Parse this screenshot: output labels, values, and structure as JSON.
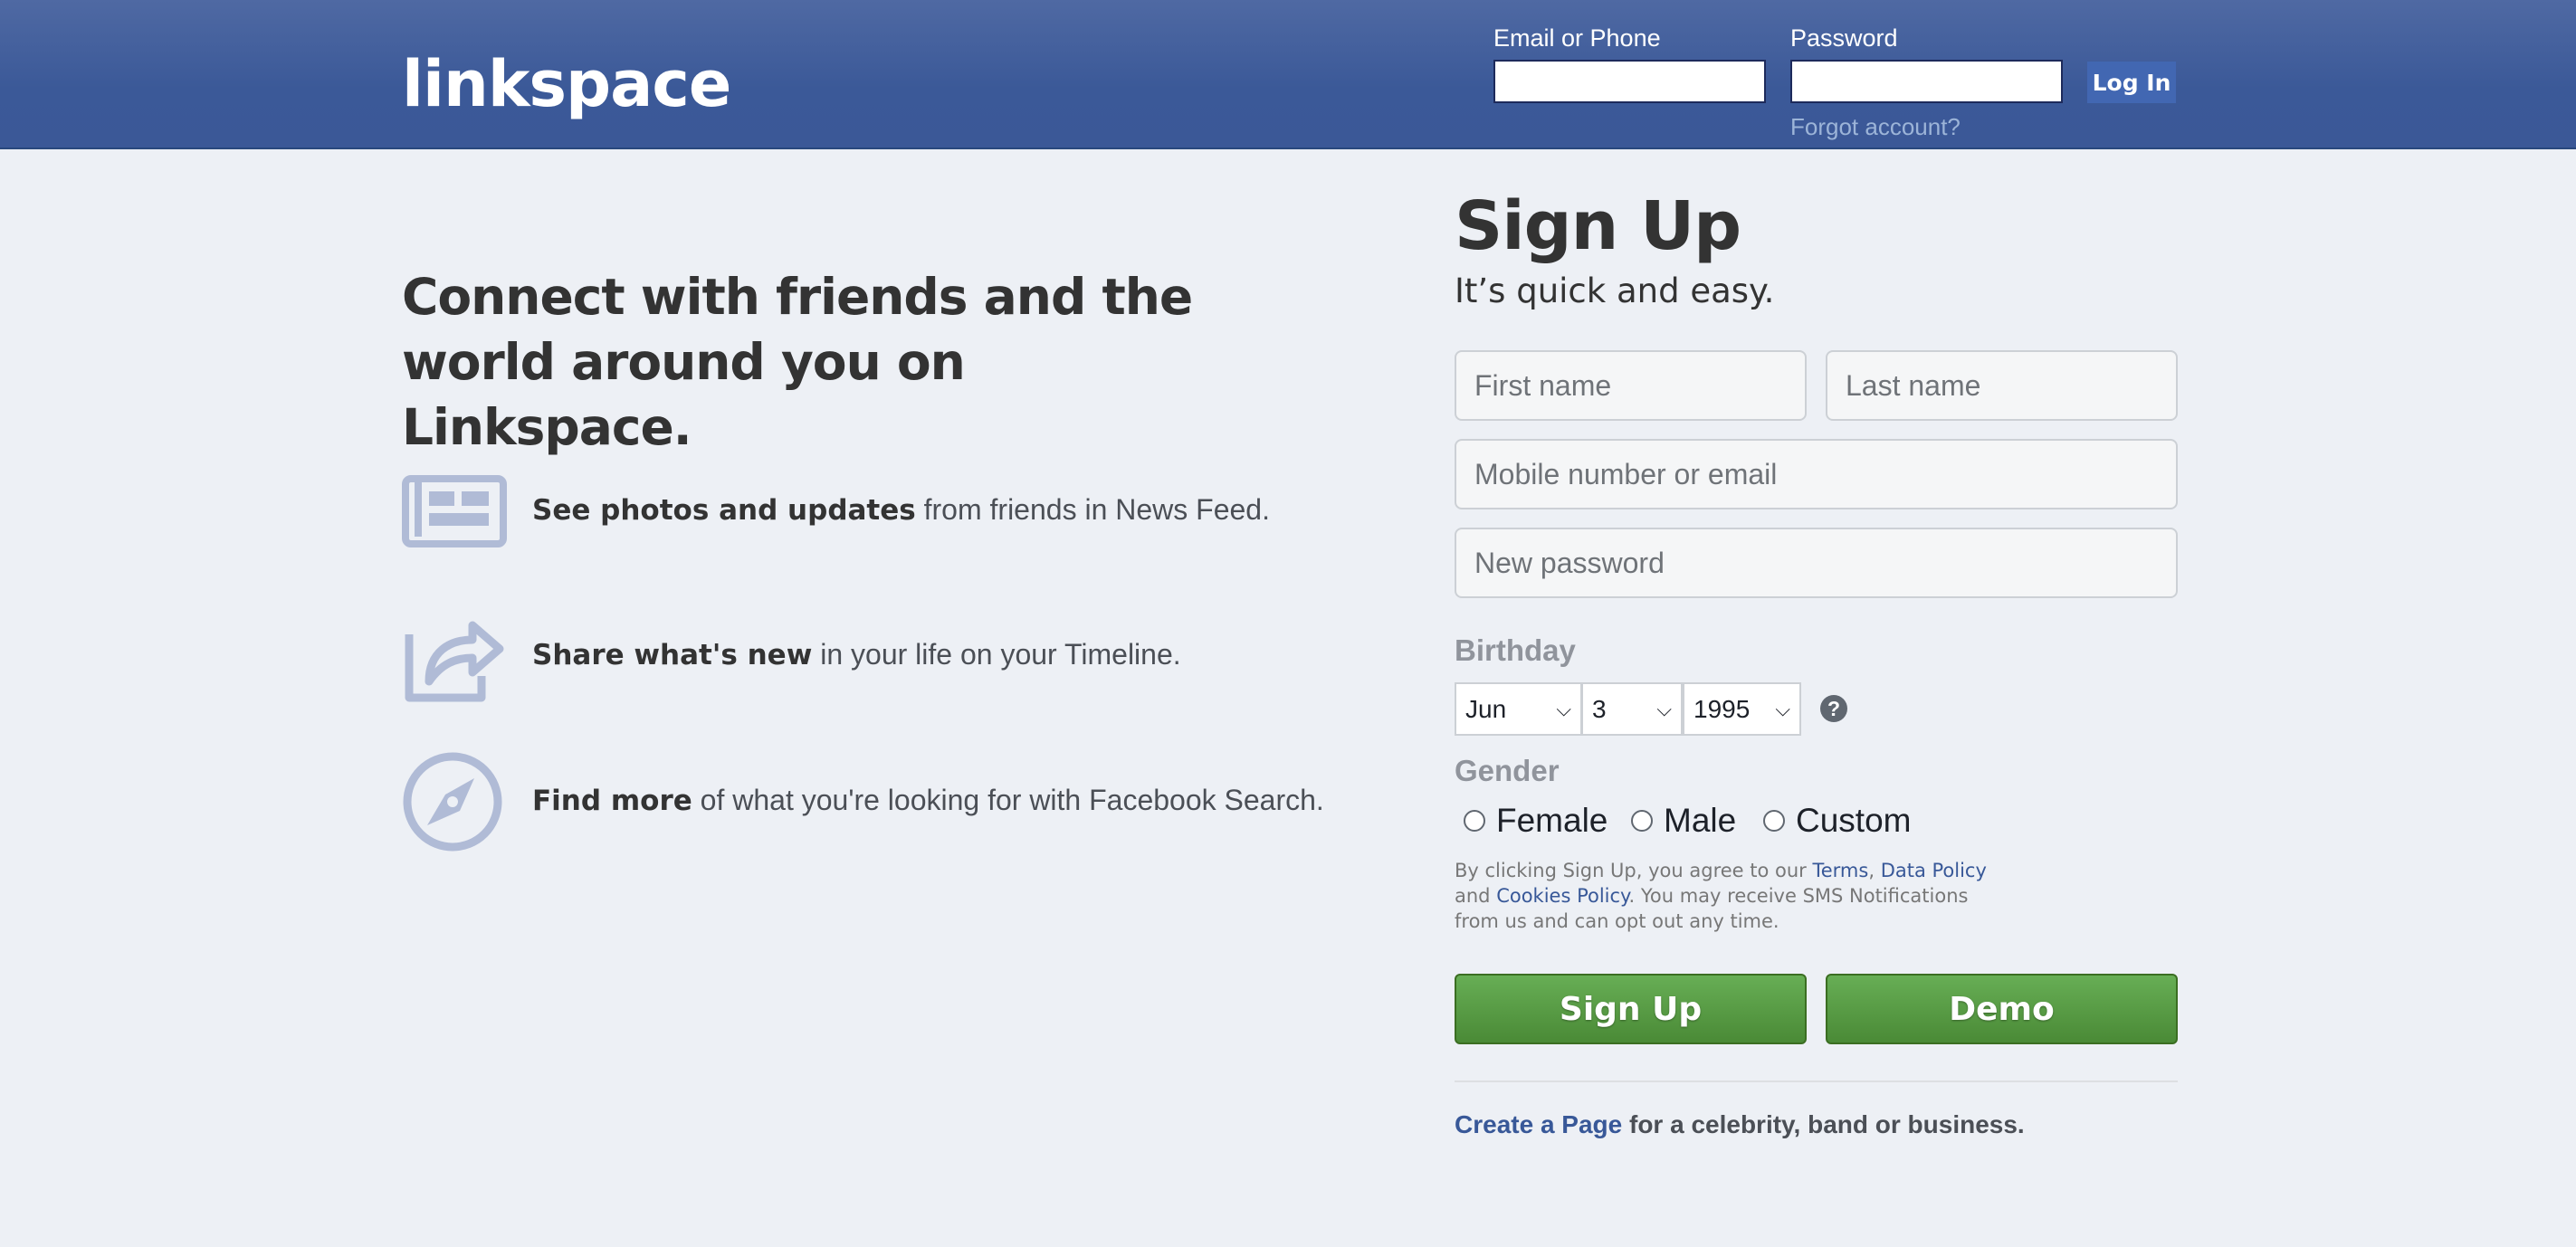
{
  "header": {
    "logo": "linkspace",
    "email_label": "Email or Phone",
    "password_label": "Password",
    "email_value": "",
    "password_value": "",
    "login_label": "Log In",
    "forgot_label": "Forgot account?"
  },
  "left": {
    "headline": "Connect with friends and the world around you on Linkspace.",
    "features": [
      {
        "icon": "news-feed-icon",
        "bold": "See photos and updates",
        "rest": "from friends in News Feed."
      },
      {
        "icon": "share-icon",
        "bold": "Share what's new",
        "rest": "in your life on your Timeline."
      },
      {
        "icon": "compass-icon",
        "bold": "Find more",
        "rest": "of what you're looking for with Facebook Search."
      }
    ]
  },
  "signup": {
    "title": "Sign Up",
    "subtitle": "It’s quick and easy.",
    "first_name_placeholder": "First name",
    "last_name_placeholder": "Last name",
    "mobile_placeholder": "Mobile number or email",
    "password_placeholder": "New password",
    "birthday_label": "Birthday",
    "birthday_month": "Jun",
    "birthday_day": "3",
    "birthday_year": "1995",
    "help_icon": "?",
    "gender_label": "Gender",
    "gender_options": [
      "Female",
      "Male",
      "Custom"
    ],
    "legal": {
      "part1": "By clicking Sign Up, you agree to our ",
      "terms": "Terms",
      "sep": ", ",
      "data_policy": "Data Policy",
      "and": " and ",
      "cookies": "Cookies Policy",
      "part2": ". You may receive SMS Notifications from us and can opt out any time."
    },
    "signup_button": "Sign Up",
    "demo_button": "Demo",
    "create_page_link": "Create a Page",
    "create_page_rest": " for a celebrity, band or business."
  },
  "colors": {
    "header_blue": "#3b5998",
    "button_green": "#4a8a36",
    "link_blue": "#385898",
    "icon_tint": "#b0bbd6"
  }
}
